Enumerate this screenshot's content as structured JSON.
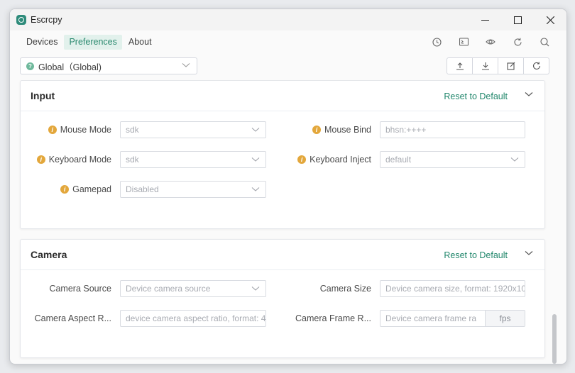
{
  "window": {
    "title": "Escrcpy"
  },
  "menu": {
    "items": [
      {
        "label": "Devices",
        "active": false
      },
      {
        "label": "Preferences",
        "active": true
      },
      {
        "label": "About",
        "active": false
      }
    ],
    "icons": [
      "history-icon",
      "cast-icon",
      "eye-icon",
      "refresh-icon",
      "search-icon"
    ]
  },
  "device_selector": {
    "value": "Global（Global)"
  },
  "toolbar_actions": [
    "upload-icon",
    "download-icon",
    "edit-icon",
    "reset-icon"
  ],
  "sections": {
    "input": {
      "title": "Input",
      "reset_label": "Reset to Default",
      "fields": {
        "mouse_mode": {
          "label": "Mouse Mode",
          "value": "sdk"
        },
        "mouse_bind": {
          "label": "Mouse Bind",
          "value": "bhsn:++++"
        },
        "keyboard_mode": {
          "label": "Keyboard Mode",
          "value": "sdk"
        },
        "keyboard_inject": {
          "label": "Keyboard Inject",
          "value": "default"
        },
        "gamepad": {
          "label": "Gamepad",
          "value": "Disabled"
        }
      }
    },
    "camera": {
      "title": "Camera",
      "reset_label": "Reset to Default",
      "fields": {
        "camera_source": {
          "label": "Camera Source",
          "placeholder": "Device camera source"
        },
        "camera_size": {
          "label": "Camera Size",
          "placeholder": "Device camera size, format: 1920x10"
        },
        "camera_aspect": {
          "label": "Camera Aspect R...",
          "placeholder": "device camera aspect ratio, format: 4"
        },
        "camera_frame": {
          "label": "Camera Frame R...",
          "placeholder": "Device camera frame ra",
          "suffix": "fps"
        }
      }
    }
  },
  "colors": {
    "accent": "#22876c",
    "menu_active_bg": "#e2f1ec",
    "info_icon": "#e3a73b"
  }
}
